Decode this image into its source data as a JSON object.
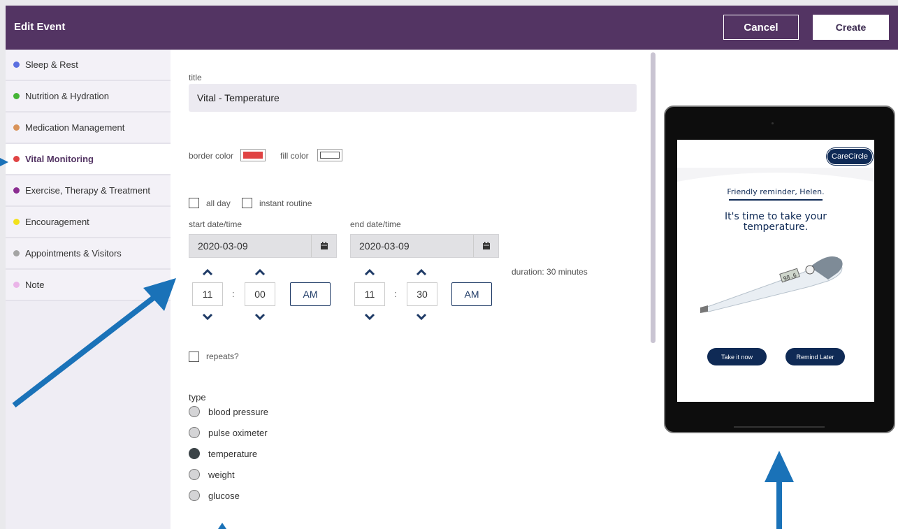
{
  "header": {
    "title": "Edit Event",
    "cancel_label": "Cancel",
    "create_label": "Create"
  },
  "sidebar": {
    "items": [
      {
        "label": "Sleep & Rest",
        "color": "#5b6fe0"
      },
      {
        "label": "Nutrition & Hydration",
        "color": "#45b536"
      },
      {
        "label": "Medication Management",
        "color": "#d9935a"
      },
      {
        "label": "Vital Monitoring",
        "color": "#e04444",
        "active": true
      },
      {
        "label": "Exercise, Therapy & Treatment",
        "color": "#8b2d91"
      },
      {
        "label": "Encouragement",
        "color": "#f2e11c"
      },
      {
        "label": "Appointments & Visitors",
        "color": "#a4a4a4"
      },
      {
        "label": "Note",
        "color": "#eab4e8"
      }
    ]
  },
  "form": {
    "title_label": "title",
    "title_value": "Vital - Temperature",
    "border_color_label": "border color",
    "border_color": "#e04444",
    "fill_color_label": "fill color",
    "fill_color": "#ffffff",
    "all_day_label": "all day",
    "instant_routine_label": "instant routine",
    "start_label": "start date/time",
    "end_label": "end date/time",
    "start_date": "2020-03-09",
    "end_date": "2020-03-09",
    "start_hour": "11",
    "start_minute": "00",
    "start_ampm": "AM",
    "end_hour": "11",
    "end_minute": "30",
    "end_ampm": "AM",
    "duration": "duration: 30 minutes",
    "repeats_label": "repeats?",
    "type_label": "type",
    "type_options": [
      {
        "label": "blood pressure",
        "selected": false
      },
      {
        "label": "pulse oximeter",
        "selected": false
      },
      {
        "label": "temperature",
        "selected": true
      },
      {
        "label": "weight",
        "selected": false
      },
      {
        "label": "glucose",
        "selected": false
      }
    ]
  },
  "preview": {
    "brand": "CareCircle",
    "reminder": "Friendly reminder, Helen.",
    "headline": "It's time to take your temperature.",
    "take_now": "Take it now",
    "remind_later": "Remind Later",
    "thermometer_reading": "98.6"
  },
  "colors": {
    "header_bg": "#533463",
    "accent_navy": "#0f2a55",
    "arrow_blue": "#1a72b8"
  }
}
